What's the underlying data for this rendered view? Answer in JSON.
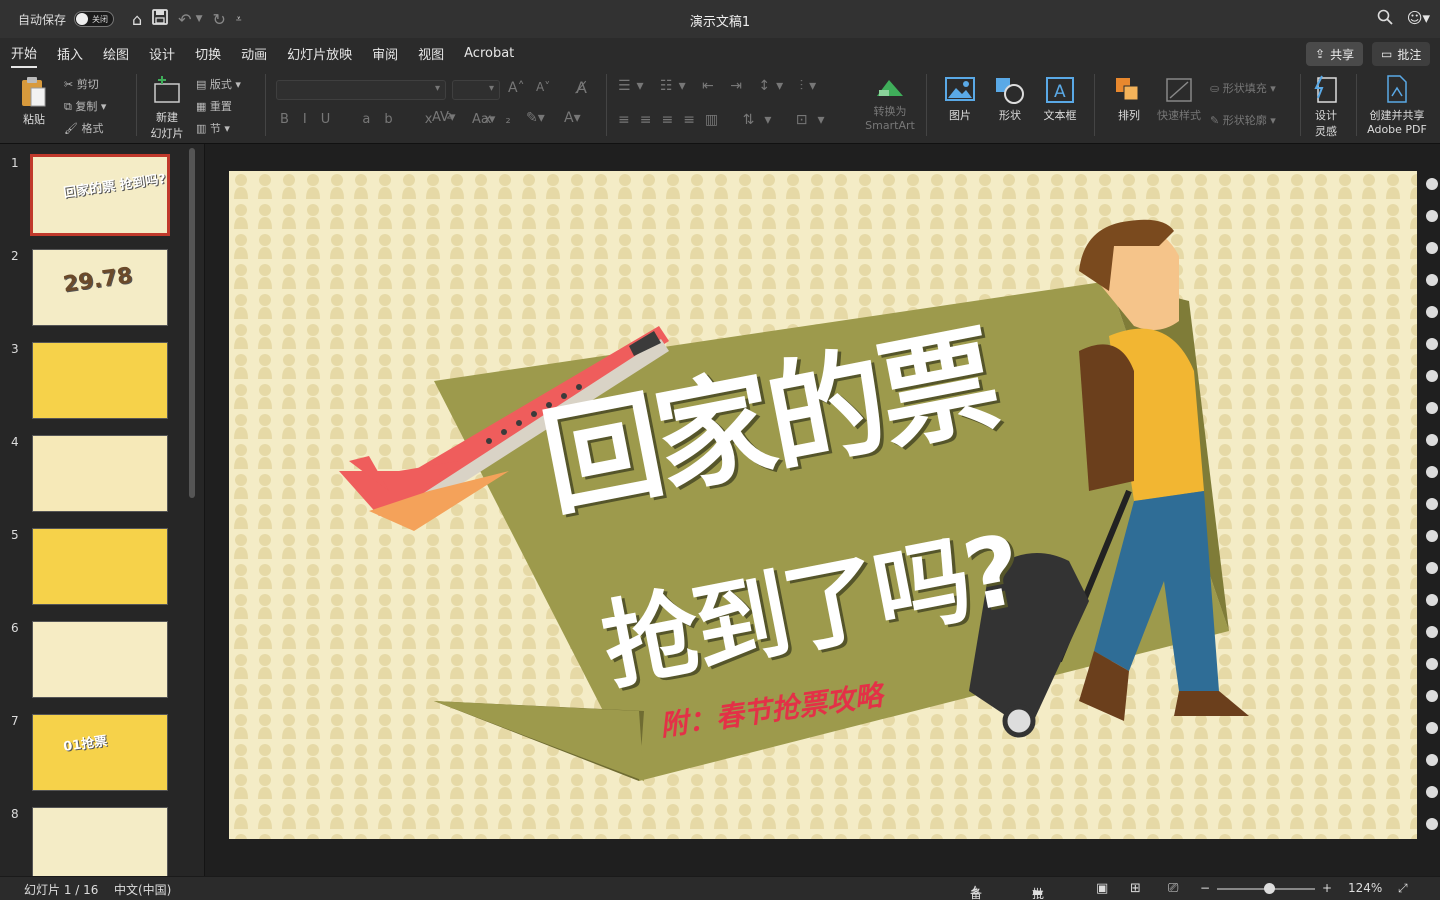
{
  "titlebar": {
    "autosave_label": "自动保存",
    "autosave_state": "关闭",
    "doc_title": "演示文稿1"
  },
  "tabs": [
    "开始",
    "插入",
    "绘图",
    "设计",
    "切换",
    "动画",
    "幻灯片放映",
    "审阅",
    "视图",
    "Acrobat"
  ],
  "actions": {
    "share": "共享",
    "comments": "批注"
  },
  "ribbon": {
    "paste": "粘贴",
    "cut": "剪切",
    "copy": "复制",
    "format": "格式",
    "new_slide_l1": "新建",
    "new_slide_l2": "幻灯片",
    "layout": "版式",
    "reset": "重置",
    "section": "节",
    "convert_l1": "转换为",
    "convert_l2": "SmartArt",
    "picture": "图片",
    "shapes": "形状",
    "textbox": "文本框",
    "arrange": "排列",
    "quick_styles": "快速样式",
    "shape_fill": "形状填充",
    "shape_outline": "形状轮廓",
    "design_ideas_l1": "设计",
    "design_ideas_l2": "灵感",
    "adobe_l1": "创建并共享",
    "adobe_l2": "Adobe PDF"
  },
  "thumbnails": [
    {
      "num": "1",
      "text": "回家的票 抢到吗?",
      "bg": "#f4ecc6"
    },
    {
      "num": "2",
      "text": "29.78",
      "bg": "#f4ecc6"
    },
    {
      "num": "3",
      "text": "",
      "bg": "#f6d24a"
    },
    {
      "num": "4",
      "text": "",
      "bg": "#f6e9b8"
    },
    {
      "num": "5",
      "text": "",
      "bg": "#f6d24a"
    },
    {
      "num": "6",
      "text": "",
      "bg": "#f6ecc4"
    },
    {
      "num": "7",
      "text": "01抢票",
      "bg": "#f6d24a"
    },
    {
      "num": "8",
      "text": "",
      "bg": "#f4ecc6"
    }
  ],
  "slide": {
    "title_line1": "回家的票",
    "title_line2": "抢到了吗?",
    "subtitle": "附：春节抢票攻略",
    "colors": {
      "background": "#f4ecc6",
      "banner": "#9d9a4c",
      "subtitle": "#e33147",
      "plane": "#ef5d5c"
    }
  },
  "status": {
    "slide_counter": "幻灯片 1 / 16",
    "language": "中文(中国)",
    "notes": "备注",
    "comments": "批注",
    "zoom": "124%"
  }
}
